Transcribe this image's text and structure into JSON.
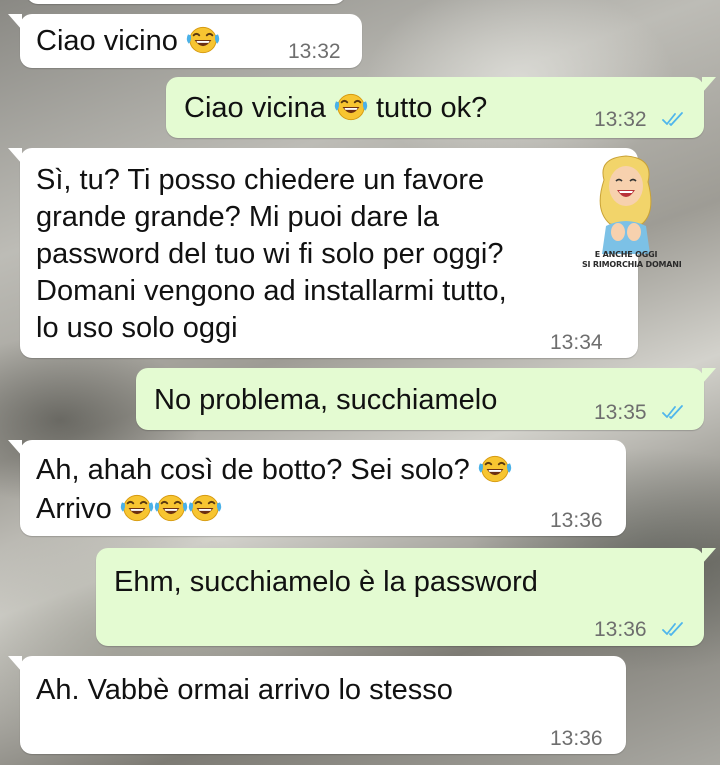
{
  "messages": [
    {
      "direction": "incoming",
      "lines": [
        "Ciao vicino"
      ],
      "emoji_after": [
        "laughing-tears"
      ],
      "time": "13:32"
    },
    {
      "direction": "outgoing",
      "lines": [
        "Ciao vicina",
        "tutto ok?"
      ],
      "time": "13:32",
      "read_status": "read"
    },
    {
      "direction": "incoming",
      "lines": [
        "Sì, tu? Ti posso chiedere un favore",
        "grande grande? Mi puoi dare la",
        "password del tuo wi fi solo per oggi?",
        "Domani vengono ad installarmi tutto,",
        "lo uso solo oggi"
      ],
      "time": "13:34"
    },
    {
      "direction": "outgoing",
      "lines": [
        "No problema, succhiamelo"
      ],
      "time": "13:35",
      "read_status": "read"
    },
    {
      "direction": "incoming",
      "lines": [
        "Ah, ahah così de botto? Sei solo?",
        "Arrivo"
      ],
      "emoji_count_line1": 1,
      "emoji_count_line2": 3,
      "time": "13:36"
    },
    {
      "direction": "outgoing",
      "lines": [
        "Ehm, succhiamelo è la password"
      ],
      "time": "13:36",
      "read_status": "read"
    },
    {
      "direction": "incoming",
      "lines": [
        "Ah. Vabbè ormai arrivo lo stesso"
      ],
      "time": "13:36"
    }
  ],
  "watermark": {
    "line1": "E ANCHE OGGI",
    "line2": "SI RIMORCHIA DOMANI"
  },
  "colors": {
    "incoming_bubble": "#ffffff",
    "outgoing_bubble": "#e4fbd2",
    "read_ticks": "#4fb6ec",
    "time_text": "#6e6e6e"
  },
  "icons": {
    "emoji": "laughing-tears-emoji",
    "read": "double-check-icon"
  }
}
